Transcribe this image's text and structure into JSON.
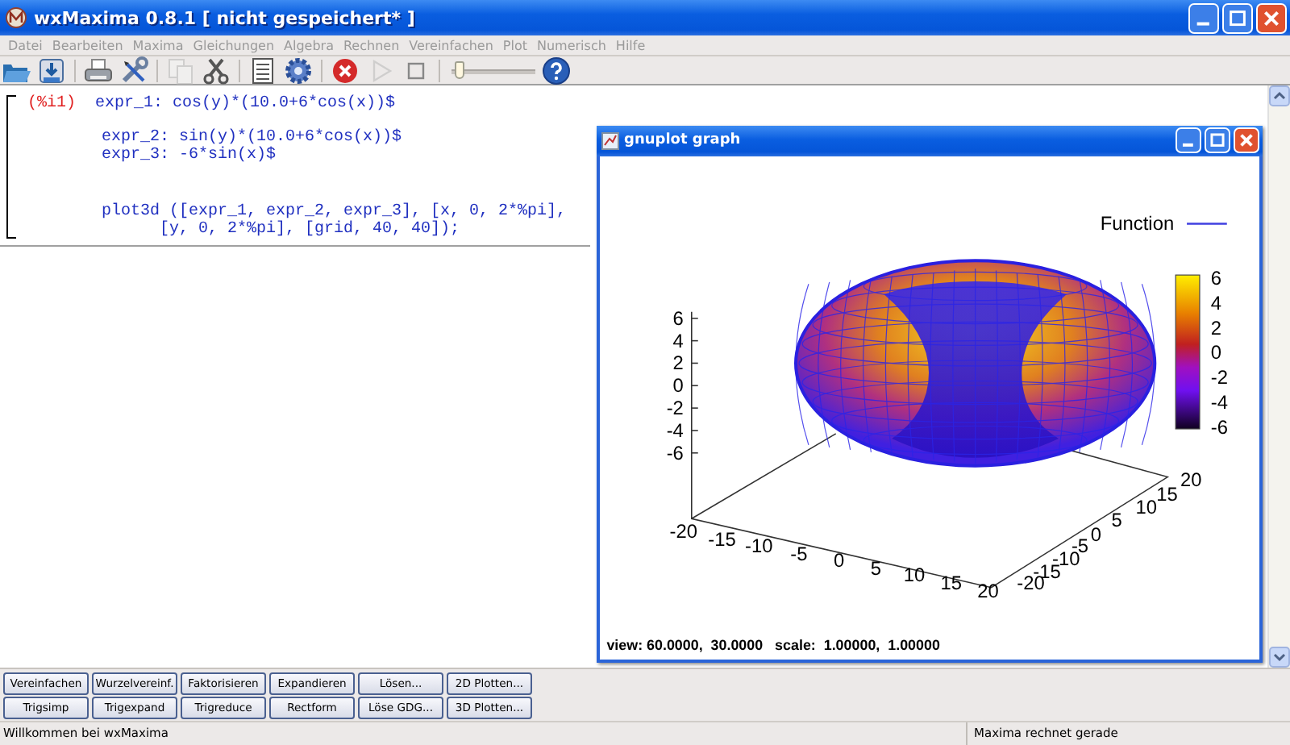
{
  "window": {
    "title": "wxMaxima 0.8.1 [ nicht gespeichert* ]"
  },
  "menu": [
    "Datei",
    "Bearbeiten",
    "Maxima",
    "Gleichungen",
    "Algebra",
    "Rechnen",
    "Vereinfachen",
    "Plot",
    "Numerisch",
    "Hilfe"
  ],
  "toolbar": {
    "buttons": [
      {
        "kind": "open",
        "disabled": false
      },
      {
        "kind": "save",
        "disabled": false
      },
      {
        "kind": "print",
        "disabled": false
      },
      {
        "kind": "tools",
        "disabled": false
      },
      {
        "kind": "copy",
        "disabled": true
      },
      {
        "kind": "cut",
        "disabled": false
      },
      {
        "kind": "lines",
        "disabled": false
      },
      {
        "kind": "gear",
        "disabled": false
      },
      {
        "kind": "interrupt",
        "disabled": false
      },
      {
        "kind": "play",
        "disabled": true
      },
      {
        "kind": "stop",
        "disabled": false
      },
      {
        "kind": "slider",
        "level": 0.05
      },
      {
        "kind": "help",
        "disabled": false
      }
    ]
  },
  "worksheet": {
    "cell": {
      "label": "(%i1)",
      "blocks": [
        [
          "expr_1: cos(y)*(10.0+6*cos(x))$"
        ],
        [
          "expr_2: sin(y)*(10.0+6*cos(x))$",
          "expr_3: -6*sin(x)$"
        ],
        [
          "plot3d ([expr_1, expr_2, expr_3], [x, 0, 2*%pi],",
          "      [y, 0, 2*%pi], [grid, 40, 40]);"
        ]
      ]
    }
  },
  "plot_window": {
    "title": "gnuplot graph",
    "legend": "Function",
    "z_ticks": [
      "6",
      "4",
      "2",
      "0",
      "-2",
      "-4",
      "-6"
    ],
    "colorbar_ticks": [
      "6",
      "4",
      "2",
      "0",
      "-2",
      "-4",
      "-6"
    ],
    "x_ticks": [
      "-20",
      "-15",
      "-10",
      "-5",
      "0",
      "5",
      "10",
      "15",
      "20"
    ],
    "y_ticks": [
      "-20",
      "-15",
      "-10",
      "-5",
      "0",
      "5",
      "10",
      "15",
      "20"
    ],
    "status": "view: 60.0000,  30.0000   scale:  1.00000,  1.00000"
  },
  "buttons": [
    [
      "Vereinfachen",
      "Wurzelvereinf.",
      "Faktorisieren",
      "Expandieren",
      "Lösen...",
      "2D Plotten..."
    ],
    [
      "Trigsimp",
      "Trigexpand",
      "Trigreduce",
      "Rectform",
      "Löse GDG...",
      "3D Plotten..."
    ]
  ],
  "status_bar": [
    "Willkommen bei wxMaxima",
    "Maxima rechnet gerade"
  ]
}
